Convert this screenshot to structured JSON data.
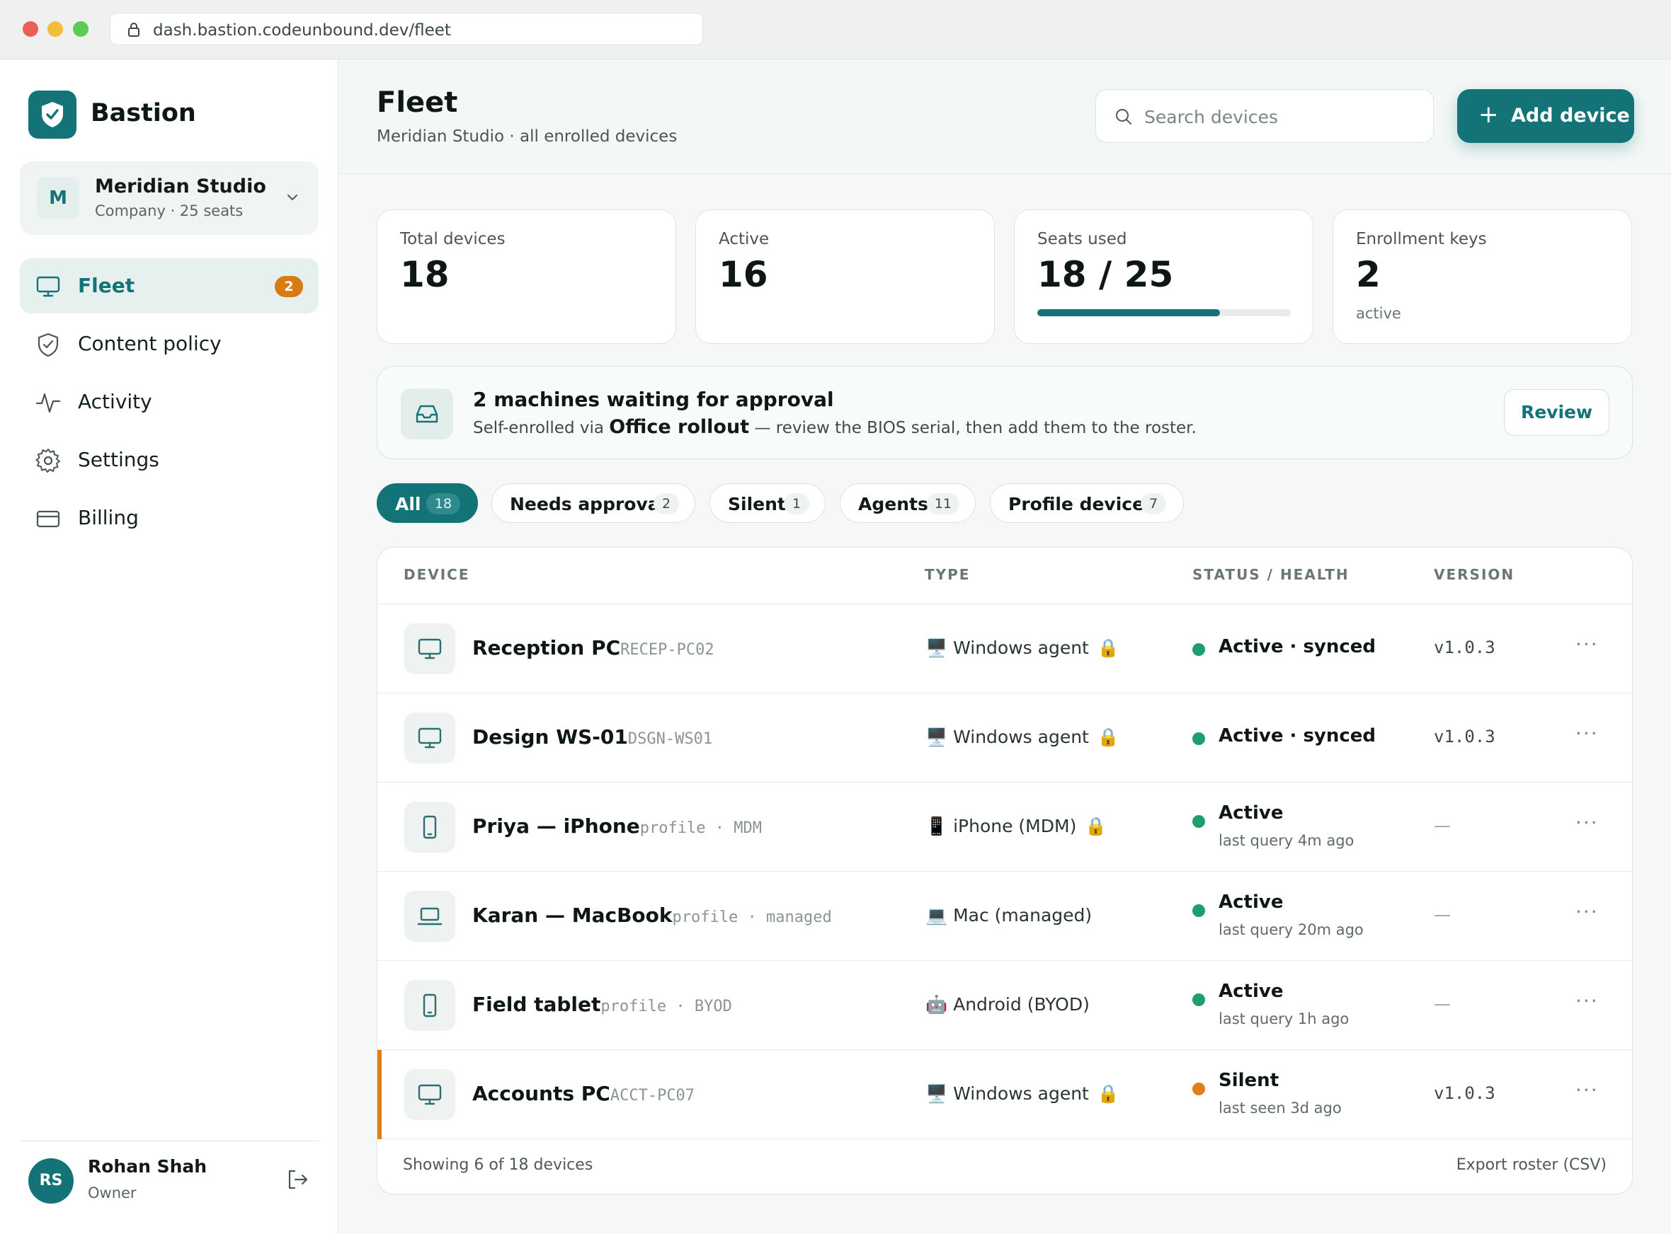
{
  "browser": {
    "url": "dash.bastion.codeunbound.dev/fleet"
  },
  "brand": {
    "name": "Bastion"
  },
  "org": {
    "initial": "M",
    "name": "Meridian Studio",
    "sub": "Company · 25 seats"
  },
  "nav": [
    {
      "label": "Fleet",
      "icon": "monitor-icon",
      "badge": "2",
      "active": true
    },
    {
      "label": "Content policy",
      "icon": "shield-icon"
    },
    {
      "label": "Activity",
      "icon": "activity-icon"
    },
    {
      "label": "Settings",
      "icon": "gear-icon"
    },
    {
      "label": "Billing",
      "icon": "card-icon"
    }
  ],
  "user": {
    "initials": "RS",
    "name": "Rohan Shah",
    "role": "Owner"
  },
  "header": {
    "title": "Fleet",
    "subtitle": "Meridian Studio · all enrolled devices",
    "search_placeholder": "Search devices",
    "add_label": "Add device",
    "add_icon": "+"
  },
  "stats": [
    {
      "label": "Total devices",
      "value": "18"
    },
    {
      "label": "Active",
      "value": "16"
    },
    {
      "label": "Seats used",
      "value": "18 / 25",
      "progress": 0.72
    },
    {
      "label": "Enrollment keys",
      "value": "2",
      "note": "active"
    }
  ],
  "banner": {
    "title": "2 machines waiting for approval",
    "sub_prefix": "Self-enrolled via ",
    "sub_bold": "Office rollout",
    "sub_suffix": " — review the BIOS serial, then add them to the roster.",
    "button": "Review"
  },
  "filters": [
    {
      "label": "All",
      "count": "18",
      "active": true
    },
    {
      "label": "Needs approval",
      "count": "2"
    },
    {
      "label": "Silent",
      "count": "1"
    },
    {
      "label": "Agents",
      "count": "11"
    },
    {
      "label": "Profile devices",
      "count": "7"
    }
  ],
  "table": {
    "headers": {
      "device": "DEVICE",
      "type": "TYPE",
      "status": "STATUS / HEALTH",
      "version": "VERSION"
    },
    "rows": [
      {
        "name": "Reception PC",
        "id": "RECEP-PC02",
        "icon": "monitor-icon",
        "type_emoji": "🖥️",
        "type": "Windows agent",
        "locked": true,
        "status": "Active · synced",
        "status_sub": "",
        "status_color": "#1f9d6a",
        "version": "v1.0.3",
        "more": "···"
      },
      {
        "name": "Design WS-01",
        "id": "DSGN-WS01",
        "icon": "monitor-icon",
        "type_emoji": "🖥️",
        "type": "Windows agent",
        "locked": true,
        "status": "Active · synced",
        "status_sub": "",
        "status_color": "#1f9d6a",
        "version": "v1.0.3",
        "more": "···"
      },
      {
        "name": "Priya — iPhone",
        "id": "profile · MDM",
        "icon": "phone-icon",
        "type_emoji": "📱",
        "type": "iPhone (MDM)",
        "locked": true,
        "status": "Active",
        "status_sub": "last query 4m ago",
        "status_color": "#1f9d6a",
        "version": "—",
        "more": "···"
      },
      {
        "name": "Karan — MacBook",
        "id": "profile · managed",
        "icon": "laptop-icon",
        "type_emoji": "💻",
        "type": "Mac (managed)",
        "locked": false,
        "status": "Active",
        "status_sub": "last query 20m ago",
        "status_color": "#1f9d6a",
        "version": "—",
        "more": "···"
      },
      {
        "name": "Field tablet",
        "id": "profile · BYOD",
        "icon": "phone-icon",
        "type_emoji": "🤖",
        "type": "Android (BYOD)",
        "locked": false,
        "status": "Active",
        "status_sub": "last query 1h ago",
        "status_color": "#1f9d6a",
        "version": "—",
        "more": "···"
      },
      {
        "name": "Accounts PC",
        "id": "ACCT-PC07",
        "icon": "monitor-icon",
        "type_emoji": "🖥️",
        "type": "Windows agent",
        "locked": true,
        "status": "Silent",
        "status_sub": "last seen 3d ago",
        "status_color": "#dd7f1b",
        "version": "v1.0.3",
        "flag": true,
        "more": "···"
      }
    ],
    "footer_left": "Showing 6 of 18 devices",
    "footer_right": "Export roster (CSV)"
  },
  "colors": {
    "accent": "#137377",
    "warning": "#dd7f1b",
    "ok": "#1f9d6a"
  }
}
